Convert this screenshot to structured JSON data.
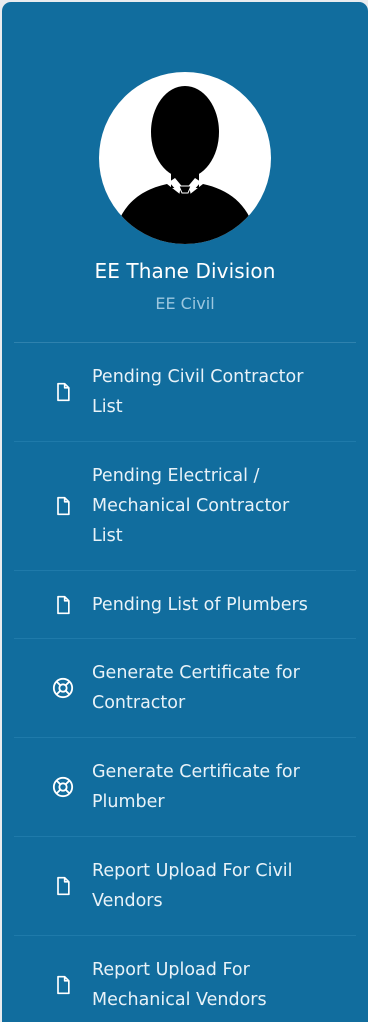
{
  "profile": {
    "name": "EE Thane Division",
    "role": "EE Civil"
  },
  "menu": {
    "items": [
      {
        "label": "Pending Civil Contractor List",
        "icon": "file-icon"
      },
      {
        "label": "Pending Electrical / Mechanical Contractor List",
        "icon": "file-icon"
      },
      {
        "label": "Pending List of Plumbers",
        "icon": "file-icon"
      },
      {
        "label": "Generate Certificate for Contractor",
        "icon": "lifebuoy-icon"
      },
      {
        "label": "Generate Certificate for Plumber",
        "icon": "lifebuoy-icon"
      },
      {
        "label": "Report Upload For Civil Vendors",
        "icon": "file-icon"
      },
      {
        "label": "Report Upload For Mechanical Vendors",
        "icon": "file-icon"
      }
    ]
  },
  "colors": {
    "sidebar_bg": "#116d9e",
    "text": "#e8f2f8",
    "role_text": "#9cc7df"
  }
}
